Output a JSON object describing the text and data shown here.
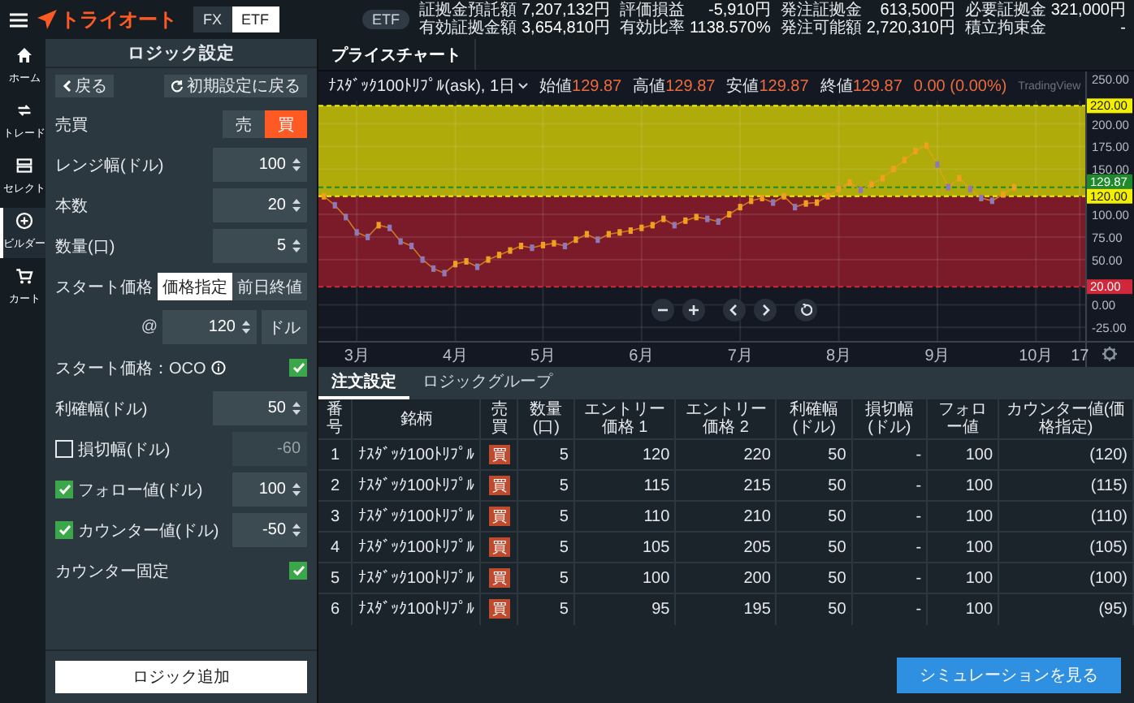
{
  "header": {
    "logo": "トライオート",
    "markets": [
      {
        "label": "FX",
        "selected": false
      },
      {
        "label": "ETF",
        "selected": true
      }
    ],
    "badge": "ETF",
    "stats": [
      {
        "label": "証拠金預託額",
        "value": "7,207,132円"
      },
      {
        "label": "評価損益",
        "value": "-5,910円"
      },
      {
        "label": "発注証拠金",
        "value": "613,500円"
      },
      {
        "label": "必要証拠金",
        "value": "321,000円"
      },
      {
        "label": "有効証拠金額",
        "value": "3,654,810円"
      },
      {
        "label": "有効比率",
        "value": "1138.570%"
      },
      {
        "label": "発注可能額",
        "value": "2,720,310円"
      },
      {
        "label": "積立拘束金",
        "value": "-"
      }
    ]
  },
  "nav": [
    {
      "label": "ホーム",
      "selected": false
    },
    {
      "label": "トレード",
      "selected": false
    },
    {
      "label": "セレクト",
      "selected": false
    },
    {
      "label": "ビルダー",
      "selected": true
    },
    {
      "label": "カート",
      "selected": false
    }
  ],
  "panel": {
    "title": "ロジック設定",
    "back": "戻る",
    "reset": "初期設定に戻る",
    "rows": [
      {
        "kind": "side",
        "label": "売買",
        "options": [
          {
            "label": "売",
            "selected": false
          },
          {
            "label": "買",
            "selected": true
          }
        ]
      },
      {
        "kind": "number",
        "label": "レンジ幅(ドル)",
        "value": "100"
      },
      {
        "kind": "number",
        "label": "本数",
        "value": "20"
      },
      {
        "kind": "number",
        "label": "数量(口)",
        "value": "5"
      },
      {
        "kind": "segment",
        "label": "スタート価格",
        "options": [
          {
            "label": "価格指定",
            "selected": true
          },
          {
            "label": "前日終値",
            "selected": false
          }
        ]
      },
      {
        "kind": "price",
        "prefix": "@",
        "value": "120",
        "unit": "ドル"
      },
      {
        "kind": "check_info",
        "label": "スタート価格：OCO",
        "checked": true
      },
      {
        "kind": "number",
        "label": "利確幅(ドル)",
        "value": "50"
      },
      {
        "kind": "check_number",
        "label": "損切幅(ドル)",
        "checked": false,
        "value": "-60",
        "disabled": true
      },
      {
        "kind": "check_number",
        "label": "フォロー値(ドル)",
        "checked": true,
        "value": "100",
        "disabled": false
      },
      {
        "kind": "check_number",
        "label": "カウンター値(ドル)",
        "checked": true,
        "value": "-50",
        "disabled": false
      },
      {
        "kind": "check",
        "label": "カウンター固定",
        "checked": true
      }
    ],
    "add_button": "ロジック追加"
  },
  "chart": {
    "tabs": [
      {
        "label": "プライスチャート",
        "selected": true
      }
    ],
    "ohlc": [
      {
        "label": "始値",
        "value": "129.87"
      },
      {
        "label": "高値",
        "value": "129.87"
      },
      {
        "label": "安値",
        "value": "129.87"
      },
      {
        "label": "終値",
        "value": "129.87"
      }
    ],
    "change": "0.00 (0.00%)",
    "attribution": "TradingView",
    "chart_data": {
      "type": "line",
      "title": "ﾅｽﾀﾞｯｸ100ﾄﾘﾌﾟﾙ(ask), 1日",
      "categories": [
        null,
        null,
        null,
        "3月",
        null,
        null,
        null,
        null,
        null,
        null,
        null,
        null,
        "4月",
        null,
        null,
        null,
        null,
        null,
        null,
        null,
        "5月",
        null,
        null,
        null,
        null,
        null,
        null,
        null,
        null,
        "6月",
        null,
        null,
        null,
        null,
        null,
        null,
        null,
        null,
        "7月",
        null,
        null,
        null,
        null,
        null,
        null,
        null,
        null,
        "8月",
        null,
        null,
        null,
        null,
        null,
        null,
        null,
        null,
        "9月",
        null,
        null,
        null,
        null,
        null,
        null,
        null,
        null,
        "10月",
        null,
        null,
        null,
        "17"
      ],
      "series": [
        {
          "color": "#f0a020",
          "marker": "square",
          "values": [
            120,
            110,
            97,
            80,
            75,
            88,
            85,
            70,
            65,
            50,
            40,
            35,
            45,
            48,
            42,
            50,
            55,
            60,
            65,
            63,
            66,
            68,
            65,
            72,
            78,
            72,
            78,
            80,
            82,
            85,
            88,
            95,
            88,
            93,
            97,
            95,
            92,
            100,
            108,
            115,
            118,
            113,
            120,
            108,
            112,
            113,
            120,
            128,
            135,
            127,
            133,
            140,
            150,
            160,
            170,
            176,
            155,
            130,
            140,
            128,
            118,
            115,
            122,
            130,
            null,
            null,
            null,
            null,
            null,
            null
          ]
        }
      ],
      "ylim": [
        -40,
        258
      ],
      "yticks": [
        {
          "value": -25,
          "label": "-25.00"
        },
        {
          "value": 0,
          "label": "0.00"
        },
        {
          "value": 50,
          "label": "50.00"
        },
        {
          "value": 75,
          "label": "75.00"
        },
        {
          "value": 100,
          "label": "100.00"
        },
        {
          "value": 150,
          "label": "150.00"
        },
        {
          "value": 175,
          "label": "175.00"
        },
        {
          "value": 200,
          "label": "200.00"
        },
        {
          "value": 250,
          "label": "250.00"
        }
      ],
      "grid": true,
      "bands": [
        {
          "axis": "y",
          "from": 120,
          "to": 220,
          "color": "#aeab0b"
        },
        {
          "axis": "y",
          "from": 20,
          "to": 120,
          "color": "#7b1b29"
        }
      ],
      "ref_lines": [
        {
          "axis": "y",
          "value": 220,
          "label": "220.00",
          "color": "#f2ef00"
        },
        {
          "axis": "y",
          "value": 129.87,
          "label": "129.87",
          "color": "#1f8a2c"
        },
        {
          "axis": "y",
          "value": 120,
          "label": "120.00",
          "color": "#f2ef00"
        },
        {
          "axis": "y",
          "value": 20,
          "label": "20.00",
          "color": "#d0283a"
        }
      ]
    }
  },
  "orders": {
    "tabs": [
      {
        "label": "注文設定",
        "selected": true
      },
      {
        "label": "ロジックグループ",
        "selected": false
      }
    ],
    "columns": [
      "番号",
      "銘柄",
      "売買",
      "数量(口)",
      "エントリー価格 1",
      "エントリー価格 2",
      "利確幅(ドル)",
      "損切幅(ドル)",
      "フォロー値",
      "カウンター値(価格指定)"
    ],
    "rows": [
      {
        "no": "1",
        "symbol": "ﾅｽﾀﾞｯｸ100ﾄﾘﾌﾟﾙ",
        "side": "買",
        "qty": "5",
        "entry1": "120",
        "entry2": "220",
        "profit": "50",
        "loss": "-",
        "follow": "100",
        "counter": "(120)"
      },
      {
        "no": "2",
        "symbol": "ﾅｽﾀﾞｯｸ100ﾄﾘﾌﾟﾙ",
        "side": "買",
        "qty": "5",
        "entry1": "115",
        "entry2": "215",
        "profit": "50",
        "loss": "-",
        "follow": "100",
        "counter": "(115)"
      },
      {
        "no": "3",
        "symbol": "ﾅｽﾀﾞｯｸ100ﾄﾘﾌﾟﾙ",
        "side": "買",
        "qty": "5",
        "entry1": "110",
        "entry2": "210",
        "profit": "50",
        "loss": "-",
        "follow": "100",
        "counter": "(110)"
      },
      {
        "no": "4",
        "symbol": "ﾅｽﾀﾞｯｸ100ﾄﾘﾌﾟﾙ",
        "side": "買",
        "qty": "5",
        "entry1": "105",
        "entry2": "205",
        "profit": "50",
        "loss": "-",
        "follow": "100",
        "counter": "(105)"
      },
      {
        "no": "5",
        "symbol": "ﾅｽﾀﾞｯｸ100ﾄﾘﾌﾟﾙ",
        "side": "買",
        "qty": "5",
        "entry1": "100",
        "entry2": "200",
        "profit": "50",
        "loss": "-",
        "follow": "100",
        "counter": "(100)"
      },
      {
        "no": "6",
        "symbol": "ﾅｽﾀﾞｯｸ100ﾄﾘﾌﾟﾙ",
        "side": "買",
        "qty": "5",
        "entry1": "95",
        "entry2": "195",
        "profit": "50",
        "loss": "-",
        "follow": "100",
        "counter": "(95)"
      }
    ],
    "simulate_button": "シミュレーションを見る"
  }
}
